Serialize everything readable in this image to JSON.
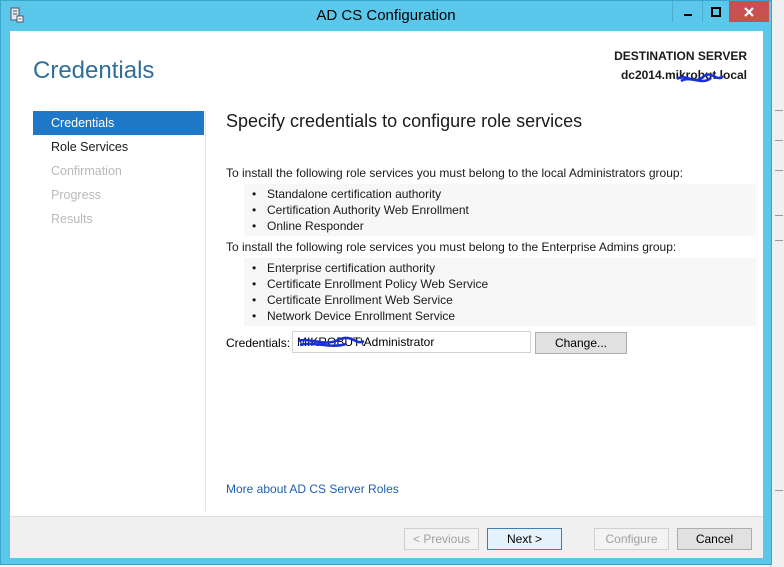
{
  "window": {
    "title": "AD CS Configuration",
    "minimize_glyph": "–",
    "maximize_glyph": "□",
    "close_glyph": "×",
    "icon": "server-role-icon",
    "accent": "#5bc7ea"
  },
  "header": {
    "page_title": "Credentials",
    "destination_label": "DESTINATION SERVER",
    "destination_server": "dc2014.mikrobut.local"
  },
  "nav": {
    "items": [
      {
        "label": "Credentials",
        "state": "active"
      },
      {
        "label": "Role Services",
        "state": "enabled"
      },
      {
        "label": "Confirmation",
        "state": "disabled"
      },
      {
        "label": "Progress",
        "state": "disabled"
      },
      {
        "label": "Results",
        "state": "disabled"
      }
    ]
  },
  "main": {
    "heading": "Specify credentials to configure role services",
    "groups": [
      {
        "intro": "To install the following role services you must belong to the local Administrators group:",
        "items": [
          "Standalone certification authority",
          "Certification Authority Web Enrollment",
          "Online Responder"
        ]
      },
      {
        "intro": "To install the following role services you must belong to the Enterprise Admins group:",
        "items": [
          "Enterprise certification authority",
          "Certificate Enrollment Policy Web Service",
          "Certificate Enrollment Web Service",
          "Network Device Enrollment Service"
        ]
      }
    ],
    "credentials_label": "Credentials:",
    "credentials_value": "MIKROBUT\\Administrator",
    "change_label": "Change...",
    "more_link": "More about AD CS Server Roles"
  },
  "footer": {
    "previous_label": "< Previous",
    "next_label": "Next >",
    "configure_label": "Configure",
    "cancel_label": "Cancel"
  }
}
